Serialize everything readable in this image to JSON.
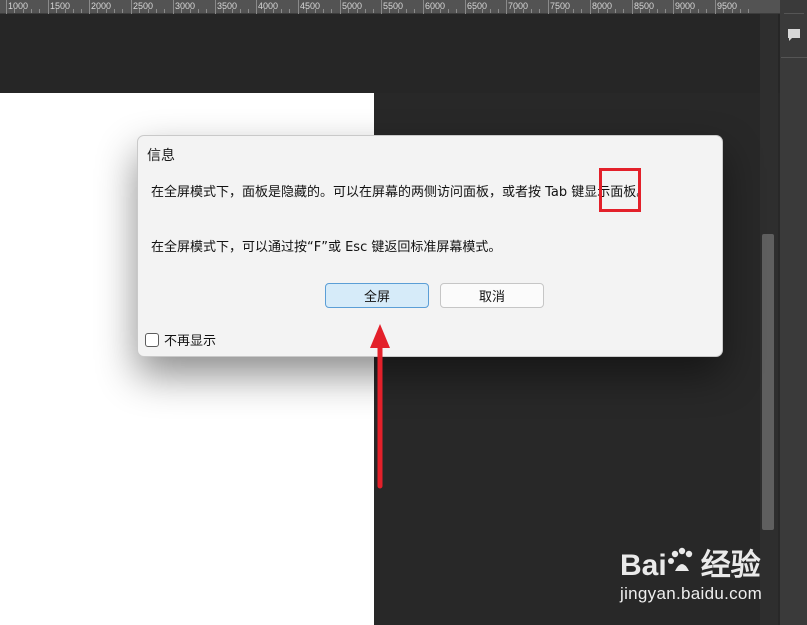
{
  "ruler": {
    "labels": [
      "1000",
      "1500",
      "2000",
      "2500",
      "3000",
      "3500",
      "4000",
      "4500",
      "5000",
      "5500",
      "6000",
      "6500",
      "7000",
      "7500",
      "8000",
      "8500",
      "9000",
      "9500"
    ]
  },
  "dialog": {
    "title": "信息",
    "paragraph1": "在全屏模式下，面板是隐藏的。可以在屏幕的两侧访问面板，或者按 Tab 键显示面板。",
    "paragraph2": "在全屏模式下，可以通过按“F”或 Esc 键返回标准屏幕模式。",
    "primary_button": "全屏",
    "secondary_button": "取消",
    "checkbox_label": "不再显示",
    "checkbox_checked": false
  },
  "watermark": {
    "logo_text": "Bai",
    "logo_suffix": "经验",
    "url": "jingyan.baidu.com"
  },
  "colors": {
    "annotation_red": "#e3202a",
    "primary_button_bg": "#d6ebf9",
    "workspace_bg": "#282828"
  },
  "icons": {
    "panel_icon": "comment-icon",
    "annotation_arrow": "arrow-up-icon"
  }
}
